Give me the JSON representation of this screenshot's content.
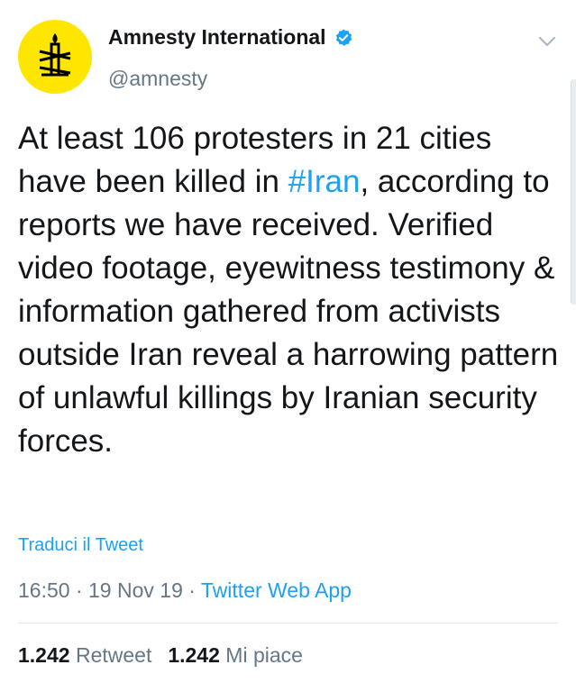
{
  "author": {
    "display_name": "Amnesty International",
    "handle": "@amnesty",
    "verified": true,
    "avatar_icon": "amnesty-candle-logo",
    "avatar_color": "#ffe600"
  },
  "tweet": {
    "text_part1": "At least 106 protesters in 21 cities have been killed in ",
    "hashtag": "#Iran",
    "text_part2": ", according to reports we have received. Verified video footage, eyewitness testimony & information gathered from activists outside Iran reveal a harrowing pattern of unlawful killings by Iranian security forces."
  },
  "translate_label": "Traduci il Tweet",
  "meta": {
    "time": "16:50",
    "separator": "·",
    "date": "19 Nov 19",
    "source": "Twitter Web App"
  },
  "stats": {
    "retweets_count": "1.242",
    "retweets_label": "Retweet",
    "likes_count": "1.242",
    "likes_label": "Mi piace"
  },
  "colors": {
    "link": "#1da1f2",
    "secondary_text": "#657786",
    "primary_text": "#14171a",
    "divider": "#e1e8ed"
  },
  "icons": {
    "verified": "verified-badge-icon",
    "menu": "chevron-down-icon"
  }
}
